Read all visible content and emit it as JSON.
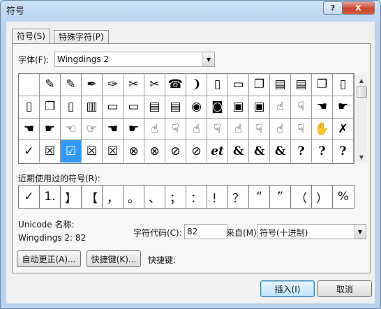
{
  "window": {
    "title": "符号",
    "help_label": "?",
    "close_label": "X"
  },
  "tabs": [
    {
      "label": "符号(S)",
      "active": true
    },
    {
      "label": "特殊字符(P)",
      "active": false
    }
  ],
  "font": {
    "label": "字体(F):",
    "value": "Wingdings 2"
  },
  "symbol_rows": [
    [
      "",
      "✎",
      "✎",
      "✒",
      "✑",
      "✂",
      "✂",
      "☎",
      "❩",
      "▯",
      "▭",
      "❐",
      "▤",
      "▤",
      "❐",
      "▯"
    ],
    [
      "▯",
      "❐",
      "▯",
      "▥",
      "▭",
      "▭",
      "▤",
      "▤",
      "◉",
      "◙",
      "▣",
      "▣",
      "☝",
      "☟",
      "☚",
      "☛"
    ],
    [
      "☚",
      "☛",
      "☜",
      "☞",
      "☚",
      "☛",
      "☝",
      "☟",
      "☝",
      "☟",
      "☝",
      "☟",
      "☝",
      "☟",
      "✋",
      "✗"
    ],
    [
      "✓",
      "☒",
      "☑",
      "☒",
      "☒",
      "⊗",
      "⊗",
      "⊘",
      "⊘",
      "et",
      "&",
      "&",
      "&",
      "?",
      "?",
      "?"
    ]
  ],
  "selected_symbol": "☑",
  "recent": {
    "label": "近期使用过的符号(R):",
    "symbols": [
      "✓",
      "1.",
      "】",
      "【",
      "，",
      "。",
      "、",
      "；",
      "：",
      "！",
      "？",
      "“",
      "”",
      "（",
      "）",
      "%"
    ]
  },
  "unicode": {
    "name_label": "Unicode 名称:",
    "name_value": "Wingdings 2: 82"
  },
  "charcode": {
    "label": "字符代码(C):",
    "value": "82"
  },
  "from": {
    "label": "来自(M):",
    "value": "符号(十进制)"
  },
  "buttons": {
    "autocorrect": "自动更正(A)...",
    "shortcut_key": "快捷键(K)...",
    "shortcut_label": "快捷键:",
    "insert": "插入(I)",
    "cancel": "取消"
  }
}
